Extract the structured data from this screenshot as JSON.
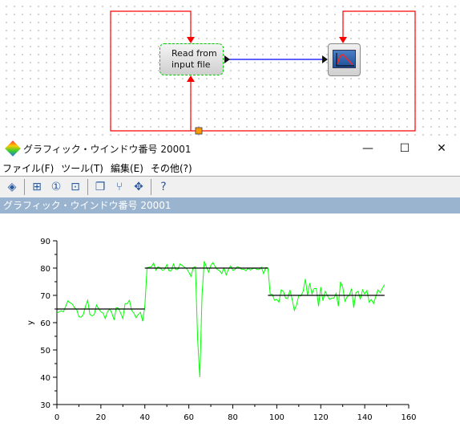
{
  "diagram": {
    "read_block_label_1": "Read from",
    "read_block_label_2": "input file",
    "link_color": "#0000ff",
    "event_color": "#ff0000",
    "selection_color": "#00cc00"
  },
  "window": {
    "title": "グラフィック・ウインドウ番号 20001",
    "minimize": "—",
    "maximize": "☐",
    "close": "✕"
  },
  "menu": [
    {
      "label": "ファイル(F)"
    },
    {
      "label": "ツール(T)"
    },
    {
      "label": "編集(E)"
    },
    {
      "label": "その他(?)"
    }
  ],
  "toolbar": [
    "rotate-icon",
    "zoom-grid-icon",
    "zoom-fit-icon",
    "zoom-area-icon",
    "window-icon",
    "datatip-icon",
    "pan-icon",
    "help-icon"
  ],
  "infobar": {
    "title": "グラフィック・ウインドウ番号 20001"
  },
  "chart_data": {
    "type": "line",
    "ylabel": "y",
    "xlabel": "",
    "xlim": [
      0,
      160
    ],
    "ylim": [
      30,
      90
    ],
    "xticks": [
      0,
      20,
      40,
      60,
      80,
      100,
      120,
      140,
      160
    ],
    "yticks": [
      30,
      40,
      50,
      60,
      70,
      80,
      90
    ],
    "series": [
      {
        "color": "#00ff00",
        "x_start": 0,
        "x_step": 1,
        "values": [
          63.5,
          64,
          64.3,
          64,
          66,
          68,
          67.3,
          66.8,
          65.5,
          64.8,
          62.2,
          62,
          63,
          66,
          68.2,
          63,
          62.5,
          63,
          66.5,
          65,
          64,
          63.5,
          61.5,
          64,
          65,
          63.5,
          61,
          65.5,
          65.3,
          63.5,
          61.5,
          67,
          67,
          68.2,
          64.5,
          63.5,
          61.8,
          63,
          63.8,
          60.5,
          66,
          80.2,
          80.3,
          80.5,
          81.8,
          79.2,
          80.5,
          80,
          79.2,
          79.5,
          81.3,
          79,
          79,
          81.5,
          79.5,
          79.5,
          81.5,
          81,
          80.3,
          79.8,
          78.5,
          77,
          80.2,
          80.5,
          54,
          40,
          70,
          82.5,
          80.5,
          78.5,
          81,
          82,
          80.5,
          79.5,
          79,
          78,
          80,
          77.5,
          79.5,
          80.8,
          79.2,
          79.5,
          80.5,
          80.2,
          79.5,
          79.6,
          79,
          80,
          79.3,
          79.8,
          80,
          79.5,
          79.5,
          80.3,
          78,
          80.2,
          80,
          70.5,
          70.3,
          68.2,
          68.5,
          67.5,
          72,
          71.5,
          69,
          68.8,
          72,
          68.5,
          64.5,
          66.5,
          70,
          69.8,
          71.5,
          76,
          70,
          74.5,
          70.5,
          72.5,
          72.5,
          66,
          73,
          68,
          71.5,
          70,
          68.5,
          69,
          69,
          70.8,
          66,
          75,
          73,
          67.8,
          69.5,
          70,
          72.5,
          65.5,
          71,
          71.5,
          68.5,
          72,
          70.5,
          71.8,
          67.5,
          68.5,
          67,
          69.5,
          72,
          71,
          72.5,
          74
        ]
      },
      {
        "color": "#000000",
        "step": true,
        "segments": [
          [
            0,
            40,
            65
          ],
          [
            40,
            96,
            80
          ],
          [
            96,
            149,
            70
          ]
        ]
      }
    ]
  }
}
